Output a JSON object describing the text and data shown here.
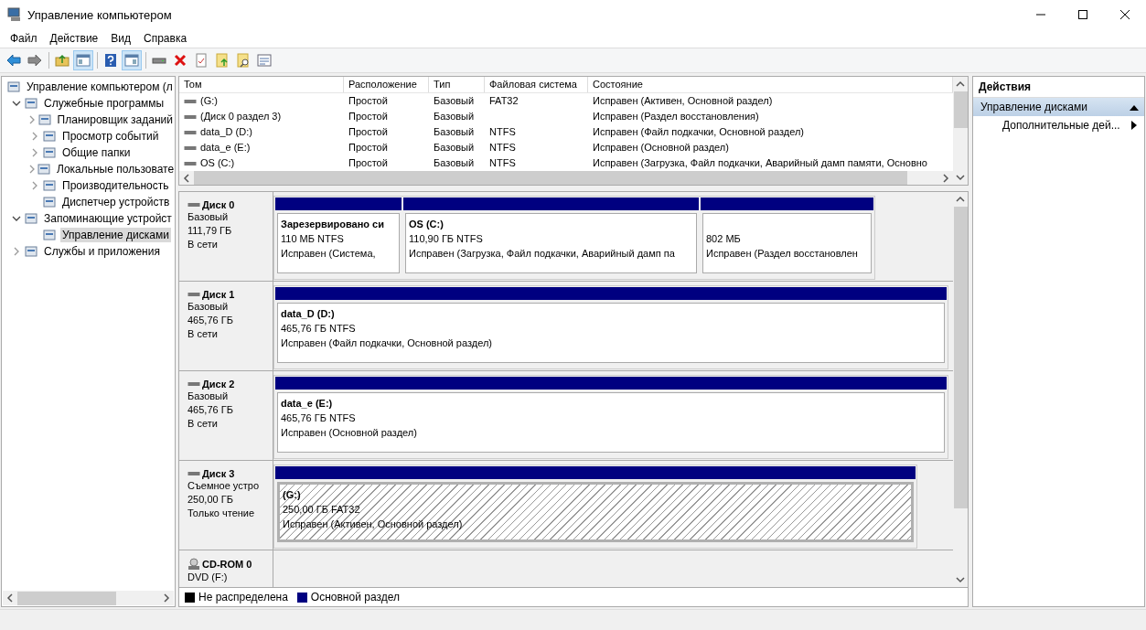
{
  "window": {
    "title": "Управление компьютером"
  },
  "menu": [
    "Файл",
    "Действие",
    "Вид",
    "Справка"
  ],
  "toolbar": [
    {
      "pressed": false
    },
    {
      "pressed": false
    },
    {
      "pressed": false
    },
    {
      "pressed": true
    },
    {
      "pressed": false
    },
    {
      "pressed": true
    },
    {
      "pressed": false
    },
    {
      "pressed": false
    },
    {
      "pressed": false
    },
    {
      "pressed": false
    },
    {
      "pressed": false
    },
    {
      "pressed": false
    }
  ],
  "tree": [
    {
      "label": "Управление компьютером (л",
      "selected": false,
      "children": [
        {
          "label": "Служебные программы",
          "expandable": true,
          "expanded": true,
          "selected": false,
          "children": [
            {
              "label": "Планировщик заданий",
              "expandable": true,
              "expanded": false,
              "selected": false
            },
            {
              "label": "Просмотр событий",
              "expandable": true,
              "expanded": false,
              "selected": false
            },
            {
              "label": "Общие папки",
              "expandable": true,
              "expanded": false,
              "selected": false
            },
            {
              "label": "Локальные пользовате",
              "expandable": true,
              "expanded": false,
              "selected": false
            },
            {
              "label": "Производительность",
              "expandable": true,
              "expanded": false,
              "selected": false
            },
            {
              "label": "Диспетчер устройств",
              "selected": false
            }
          ]
        },
        {
          "label": "Запоминающие устройст",
          "expandable": true,
          "expanded": true,
          "selected": false,
          "children": [
            {
              "label": "Управление дисками",
              "selected": true
            }
          ]
        },
        {
          "label": "Службы и приложения",
          "expandable": true,
          "expanded": false,
          "selected": false
        }
      ]
    }
  ],
  "table": {
    "columns": [
      "Том",
      "Расположение",
      "Тип",
      "Файловая система",
      "Состояние"
    ],
    "rows": [
      [
        "(G:)",
        "Простой",
        "Базовый",
        "FAT32",
        "Исправен (Активен, Основной раздел)"
      ],
      [
        "(Диск 0 раздел 3)",
        "Простой",
        "Базовый",
        "",
        "Исправен (Раздел восстановления)"
      ],
      [
        "data_D (D:)",
        "Простой",
        "Базовый",
        "NTFS",
        "Исправен (Файл подкачки, Основной раздел)"
      ],
      [
        "data_e (E:)",
        "Простой",
        "Базовый",
        "NTFS",
        "Исправен (Основной раздел)"
      ],
      [
        "OS (C:)",
        "Простой",
        "Базовый",
        "NTFS",
        "Исправен (Загрузка, Файл подкачки, Аварийный дамп памяти, Основно"
      ]
    ]
  },
  "disks": [
    {
      "name": "Диск 0",
      "kind": "disk",
      "lines": [
        "Базовый",
        "111,79 ГБ",
        "В сети"
      ],
      "partitions": [
        {
          "title": "Зарезервировано си",
          "size": "110 МБ NTFS",
          "status": "Исправен (Система,",
          "selected": false
        },
        {
          "title": "OS  (C:)",
          "size": "110,90 ГБ NTFS",
          "status": "Исправен (Загрузка, Файл подкачки, Аварийный дамп па",
          "selected": false
        },
        {
          "size": "802 МБ",
          "status": "Исправен (Раздел восстановлен",
          "selected": false
        }
      ]
    },
    {
      "name": "Диск 1",
      "kind": "disk",
      "lines": [
        "Базовый",
        "465,76 ГБ",
        "В сети"
      ],
      "partitions": [
        {
          "title": "data_D  (D:)",
          "size": "465,76 ГБ NTFS",
          "status": "Исправен (Файл подкачки, Основной раздел)",
          "selected": false
        }
      ]
    },
    {
      "name": "Диск 2",
      "kind": "disk",
      "lines": [
        "Базовый",
        "465,76 ГБ",
        "В сети"
      ],
      "partitions": [
        {
          "title": "data_e  (E:)",
          "size": "465,76 ГБ NTFS",
          "status": "Исправен (Основной раздел)",
          "selected": false
        }
      ]
    },
    {
      "name": "Диск 3",
      "kind": "disk",
      "lines": [
        "Съемное устро",
        "250,00 ГБ",
        "Только чтение"
      ],
      "partitions": [
        {
          "title": "(G:)",
          "size": "250,00 ГБ FAT32",
          "status": "Исправен (Активен, Основной раздел)",
          "selected": true
        }
      ]
    },
    {
      "name": "CD-ROM 0",
      "kind": "cdrom",
      "lines": [
        "DVD (F:)"
      ]
    }
  ],
  "legend": [
    {
      "label": "Не распределена",
      "color": "#000000"
    },
    {
      "label": "Основной раздел",
      "color": "#000080"
    }
  ],
  "actions": {
    "title": "Действия",
    "section": {
      "label": "Управление дисками",
      "expanded": true
    },
    "items": [
      {
        "label": "Дополнительные дей..."
      }
    ]
  }
}
